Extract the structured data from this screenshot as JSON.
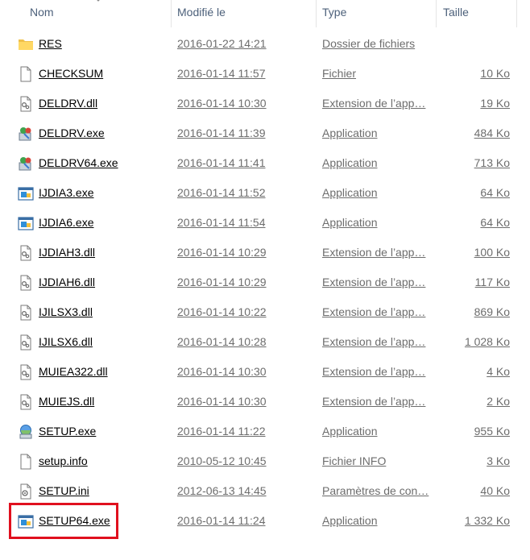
{
  "columns": {
    "name": "Nom",
    "modified": "Modifié le",
    "type": "Type",
    "size": "Taille"
  },
  "files": [
    {
      "name": "RES",
      "date": "2016-01-22 14:21",
      "type": "Dossier de fichiers",
      "size": "",
      "icon": "folder-icon"
    },
    {
      "name": "CHECKSUM",
      "date": "2016-01-14 11:57",
      "type": "Fichier",
      "size": "10 Ko",
      "icon": "file-icon"
    },
    {
      "name": "DELDRV.dll",
      "date": "2016-01-14 10:30",
      "type": "Extension de l’app…",
      "size": "19 Ko",
      "icon": "dll-icon"
    },
    {
      "name": "DELDRV.exe",
      "date": "2016-01-14 11:39",
      "type": "Application",
      "size": "484 Ko",
      "icon": "installer-icon"
    },
    {
      "name": "DELDRV64.exe",
      "date": "2016-01-14 11:41",
      "type": "Application",
      "size": "713 Ko",
      "icon": "installer-icon"
    },
    {
      "name": "IJDIA3.exe",
      "date": "2016-01-14 11:52",
      "type": "Application",
      "size": "64 Ko",
      "icon": "app-icon"
    },
    {
      "name": "IJDIA6.exe",
      "date": "2016-01-14 11:54",
      "type": "Application",
      "size": "64 Ko",
      "icon": "app-icon"
    },
    {
      "name": "IJDIAH3.dll",
      "date": "2016-01-14 10:29",
      "type": "Extension de l’app…",
      "size": "100 Ko",
      "icon": "dll-icon"
    },
    {
      "name": "IJDIAH6.dll",
      "date": "2016-01-14 10:29",
      "type": "Extension de l’app…",
      "size": "117 Ko",
      "icon": "dll-icon"
    },
    {
      "name": "IJILSX3.dll",
      "date": "2016-01-14 10:22",
      "type": "Extension de l’app…",
      "size": "869 Ko",
      "icon": "dll-icon"
    },
    {
      "name": "IJILSX6.dll",
      "date": "2016-01-14 10:28",
      "type": "Extension de l’app…",
      "size": "1 028 Ko",
      "icon": "dll-icon"
    },
    {
      "name": "MUIEA322.dll",
      "date": "2016-01-14 10:30",
      "type": "Extension de l’app…",
      "size": "4 Ko",
      "icon": "dll-icon"
    },
    {
      "name": "MUIEJS.dll",
      "date": "2016-01-14 10:30",
      "type": "Extension de l’app…",
      "size": "2 Ko",
      "icon": "dll-icon"
    },
    {
      "name": "SETUP.exe",
      "date": "2016-01-14 11:22",
      "type": "Application",
      "size": "955 Ko",
      "icon": "setup-icon"
    },
    {
      "name": "setup.info",
      "date": "2010-05-12 10:45",
      "type": "Fichier INFO",
      "size": "3 Ko",
      "icon": "file-icon"
    },
    {
      "name": "SETUP.ini",
      "date": "2012-06-13 14:45",
      "type": "Paramètres de con…",
      "size": "40 Ko",
      "icon": "settings-file-icon"
    },
    {
      "name": "SETUP64.exe",
      "date": "2016-01-14 11:24",
      "type": "Application",
      "size": "1 332 Ko",
      "icon": "app-icon"
    }
  ],
  "colors": {
    "highlight": "#e0101e",
    "header_text": "#4c607a",
    "detail_text": "#6d6d6d"
  }
}
